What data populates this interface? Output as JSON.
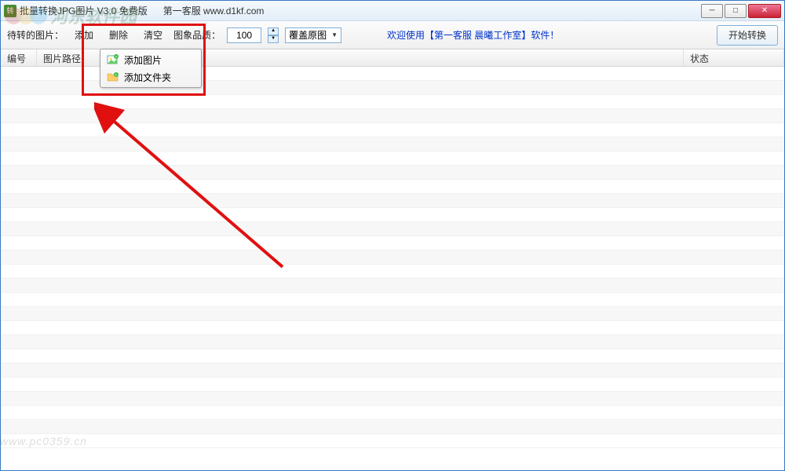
{
  "titlebar": {
    "app_title": "批量转换JPG图片 V3.0 免费版",
    "site_info": "第一客服 www.d1kf.com"
  },
  "toolbar": {
    "label_images": "待转的图片：",
    "add": "添加",
    "delete": "删除",
    "clear": "清空",
    "quality_label": "图象品质：",
    "quality_value": "100",
    "overwrite_label": "覆盖原图",
    "welcome": "欢迎使用【第一客服 晨曦工作室】软件！",
    "start_btn": "开始转换"
  },
  "columns": {
    "col1": "编号",
    "col2": "图片路径",
    "col3": "状态"
  },
  "dropdown": {
    "item1": "添加图片",
    "item2": "添加文件夹"
  },
  "watermark": {
    "brand": "河东软件园",
    "url": "www.pc0359.cn"
  }
}
